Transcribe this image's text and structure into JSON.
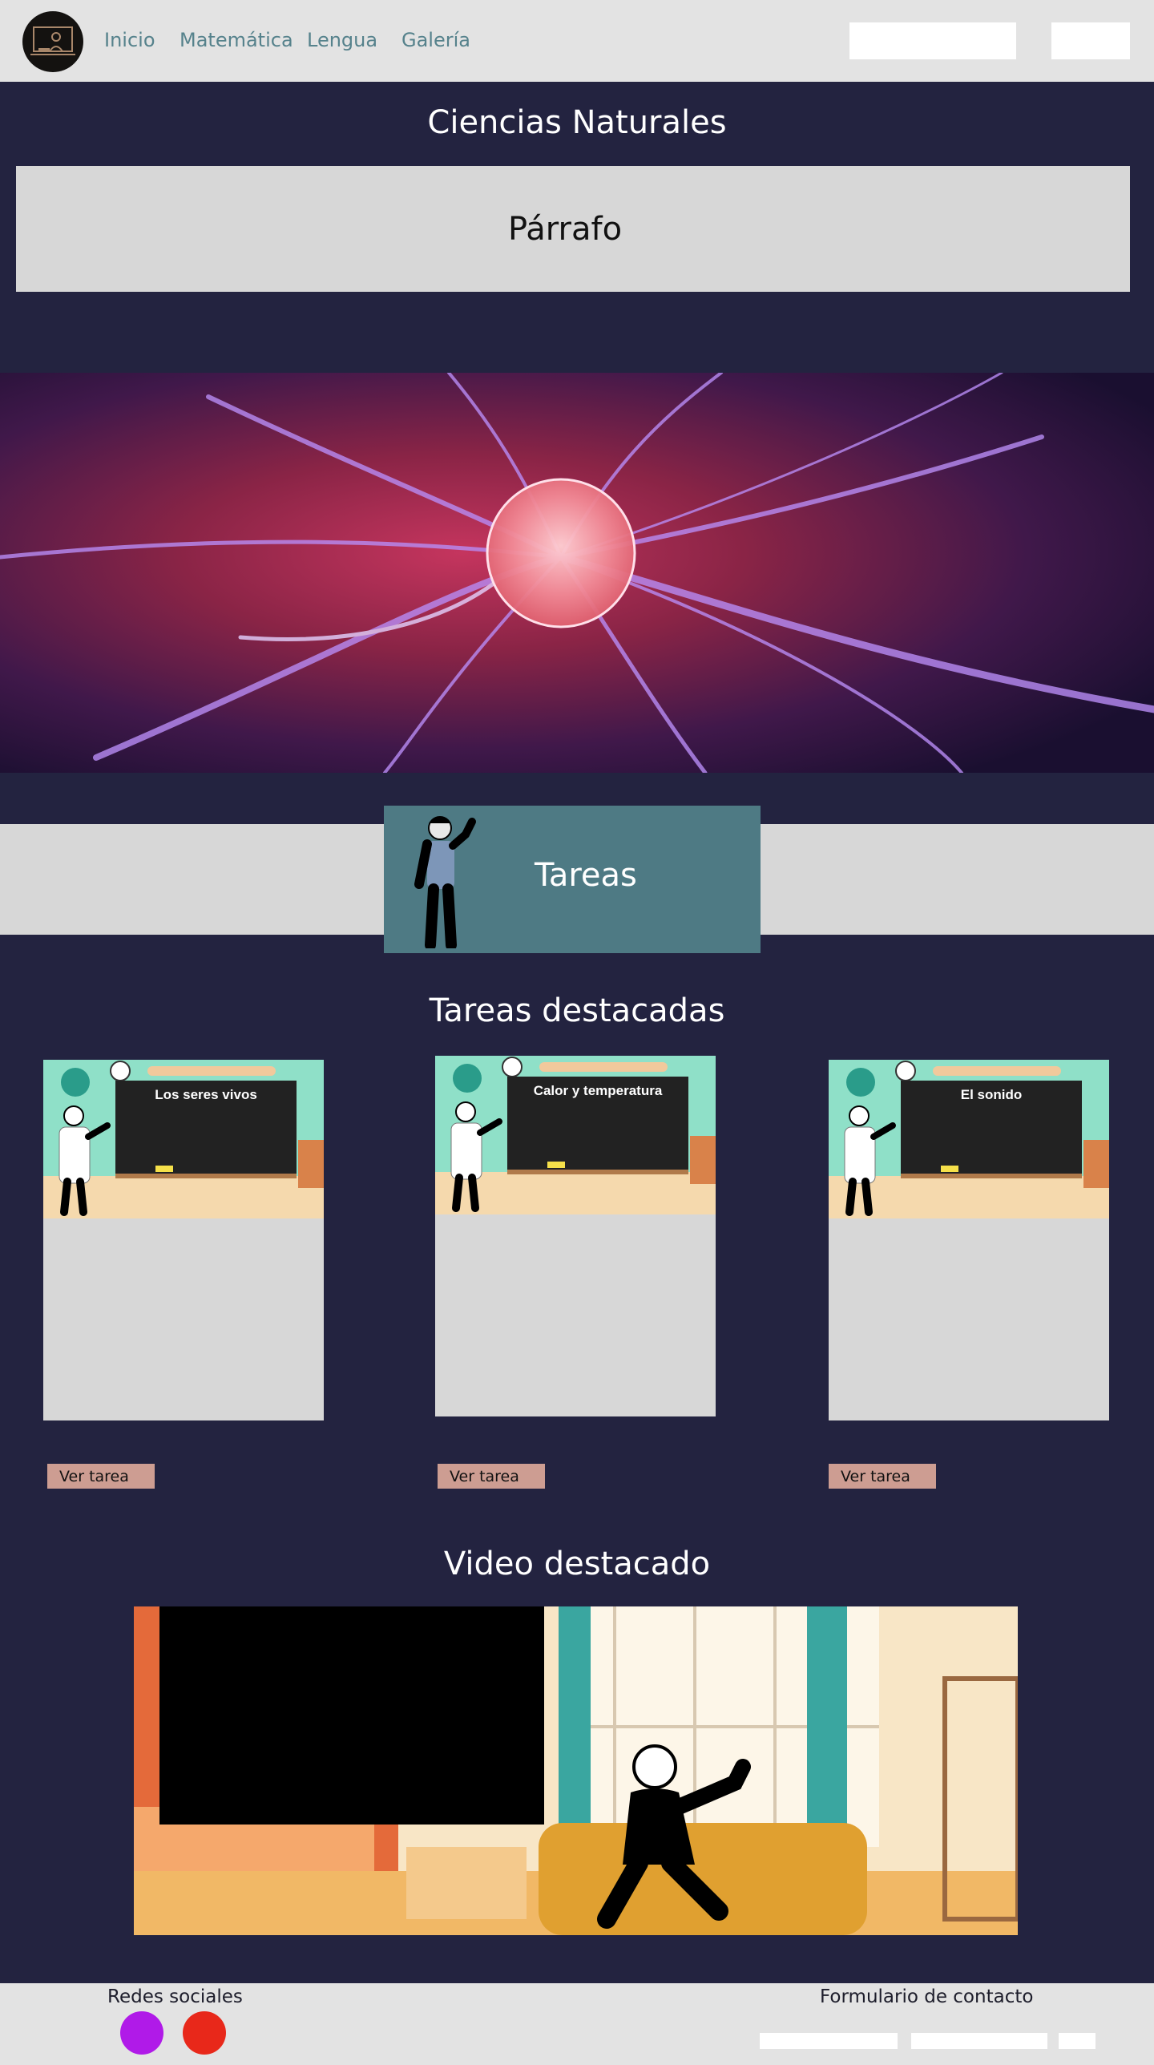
{
  "nav": {
    "logo": "chalkboard-teacher-logo",
    "links": [
      "Inicio",
      "Matemática",
      "Lengua",
      "Galería"
    ],
    "search_value": "",
    "button_label": ""
  },
  "hero": {
    "title": "Ciencias Naturales",
    "paragraph": "Párrafo",
    "banner_image": "plasma-ball-image"
  },
  "tareas_band": {
    "title": "Tareas"
  },
  "featured_tasks": {
    "title": "Tareas destacadas",
    "cards": [
      {
        "board_text": "Los seres vivos",
        "button": "Ver tarea"
      },
      {
        "board_text": "Calor y temperatura",
        "button": "Ver tarea"
      },
      {
        "board_text": "El sonido",
        "button": "Ver tarea"
      }
    ]
  },
  "featured_video": {
    "title": "Video destacado"
  },
  "footer": {
    "social_label": "Redes sociales",
    "contact_label": "Formulario de contacto",
    "social_colors": [
      "#b01ae8",
      "#e8281a"
    ]
  },
  "colors": {
    "page_bg": "#232340",
    "nav_bg": "#e3e3e3",
    "panel_gray": "#d7d7d7",
    "teal": "#4e7a84",
    "button_salmon": "#cd9d92",
    "link": "#56828c"
  }
}
